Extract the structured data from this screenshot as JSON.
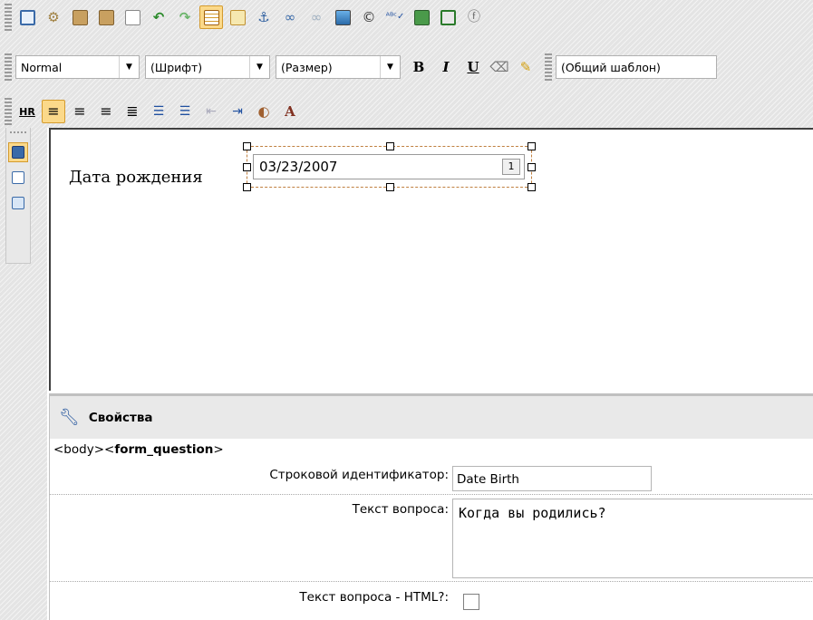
{
  "toolbar1": {
    "icons": [
      "window-icon",
      "gear-icon",
      "paste-word-icon",
      "paste-text-icon",
      "select-all-icon",
      "undo-icon",
      "redo-icon",
      "table-icon",
      "form-icon",
      "anchor-icon",
      "link-icon",
      "unlink-icon",
      "image-icon",
      "copyright-icon",
      "spellcheck-icon",
      "template-icon",
      "save-icon",
      "flash-icon"
    ]
  },
  "toolbar2": {
    "style_value": "Normal",
    "font_value": "(Шрифт)",
    "size_value": "(Размер)",
    "bold": "B",
    "italic": "I",
    "underline": "U",
    "template_value": "(Общий шаблон)"
  },
  "toolbar3": {
    "hr_label": "HR",
    "icons": [
      "align-left-icon",
      "align-center-icon",
      "align-right-icon",
      "justify-icon",
      "ordered-list-icon",
      "bullet-list-icon",
      "outdent-icon",
      "indent-icon",
      "text-color-icon",
      "bg-color-icon"
    ]
  },
  "editor": {
    "label": "Дата рождения",
    "date_value": "03/23/2007",
    "calendar_glyph": "1"
  },
  "properties": {
    "title": "Свойства",
    "breadcrumb_prefix": "<body><",
    "breadcrumb_tag": "form_question",
    "breadcrumb_suffix": ">",
    "id_label": "Строковой идентификатор:",
    "id_value": "Date Birth",
    "question_label": "Текст вопроса:",
    "question_value": "Когда вы родились?",
    "html_label": "Текст вопроса - HTML?:"
  },
  "colors": {
    "active_button": "#fbd98a",
    "active_border": "#d49b2e",
    "toolbar_bg": "#e4e4e4"
  }
}
